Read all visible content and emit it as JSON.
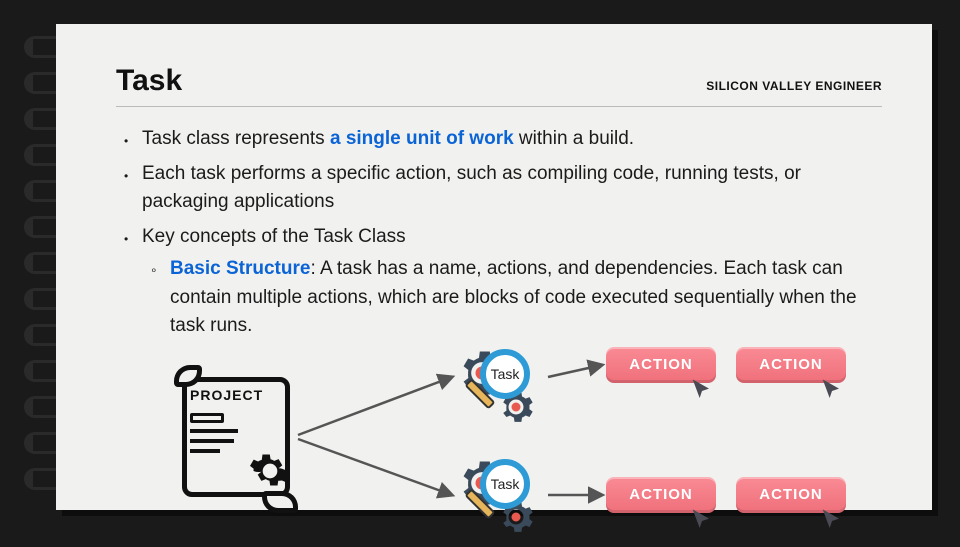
{
  "header": {
    "title": "Task",
    "brand": "SILICON VALLEY ENGINEER"
  },
  "bullets": {
    "b1_pre": "Task class represents ",
    "b1_em": "a single unit of work",
    "b1_post": " within a build.",
    "b2": "Each task performs a specific action, such as compiling code, running tests, or packaging applications",
    "b3": "Key concepts of the Task Class",
    "s1_em": "Basic Structure",
    "s1_post": ": A task has a name, actions, and dependencies. Each task can contain multiple actions, which are blocks of code executed sequentially when the task runs."
  },
  "diagram": {
    "project_label": "PROJECT",
    "task_label_1": "Task",
    "task_label_2": "Task",
    "action_label": "ACTION"
  }
}
